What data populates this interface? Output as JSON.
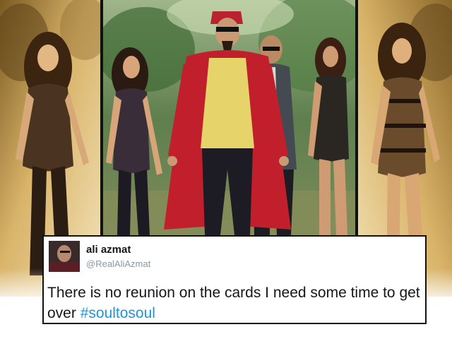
{
  "tweet": {
    "author": {
      "display_name": "ali azmat",
      "handle": "@RealAliAzmat"
    },
    "text_before_hashtag": "There is no reunion on the cards I need some time to get over ",
    "hashtag": "#soultosoul"
  },
  "colors": {
    "hashtag": "#1b95e0",
    "handle": "#8899a6",
    "border": "#111111",
    "sepia_tone": "#c9a45c"
  },
  "icons": {
    "avatar": "profile-photo-avatar"
  }
}
